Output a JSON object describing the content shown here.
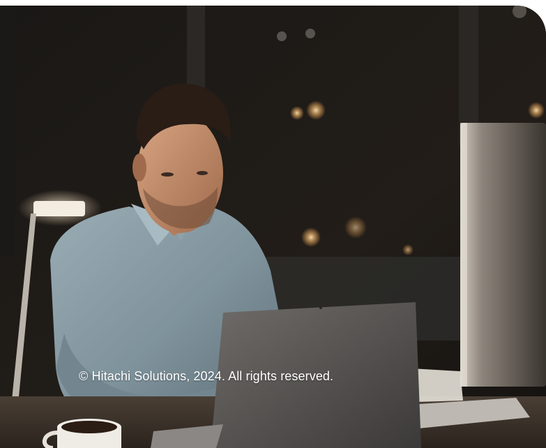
{
  "photo": {
    "subject": "man-working-on-laptop-at-night-office"
  },
  "caption": {
    "text": "© Hitachi Solutions, 2024. All rights reserved."
  }
}
